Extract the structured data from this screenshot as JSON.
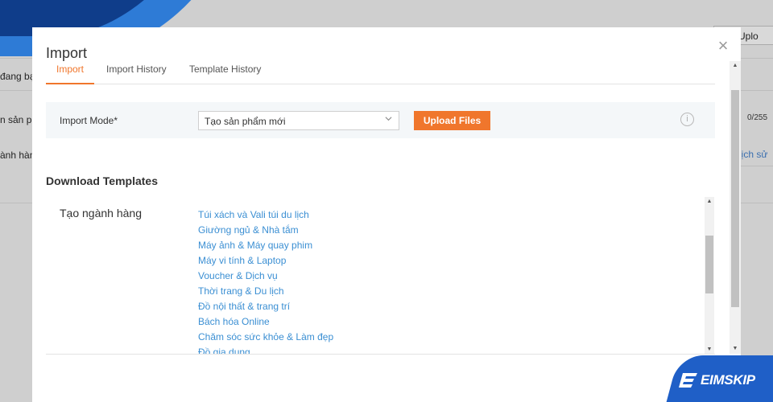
{
  "background": {
    "row1": "đang bạ",
    "row2": "n sản ph",
    "row3": "ành hàn",
    "right_button": "ch Uplo",
    "counter": "0/255",
    "history_link": "lịch sử"
  },
  "modal": {
    "title": "Import",
    "close_glyph": "×",
    "tabs": [
      {
        "label": "Import",
        "active": true
      },
      {
        "label": "Import History",
        "active": false
      },
      {
        "label": "Template History",
        "active": false
      }
    ],
    "import_mode": {
      "label": "Import Mode*",
      "selected": "Tạo sản phẩm mới",
      "upload_label": "Upload Files",
      "info_glyph": "i"
    },
    "download": {
      "title": "Download Templates",
      "category_label": "Tạo ngành hàng",
      "templates": [
        "Túi xách và Vali túi du lịch",
        "Giường ngủ & Nhà tắm",
        "Máy ảnh & Máy quay phim",
        "Máy vi tính & Laptop",
        "Voucher & Dịch vụ",
        "Thời trang & Du lịch",
        "Đồ nội thất & trang trí",
        "Bách hóa Online",
        "Chăm sóc sức khỏe & Làm đẹp",
        "Đồ gia dụng"
      ]
    }
  },
  "brand": {
    "name": "EIMSKIP"
  },
  "colors": {
    "accent": "#f0762c",
    "link": "#3b8fd3",
    "brand_blue": "#1f5fc7",
    "brand_dark": "#0f3d8a"
  }
}
